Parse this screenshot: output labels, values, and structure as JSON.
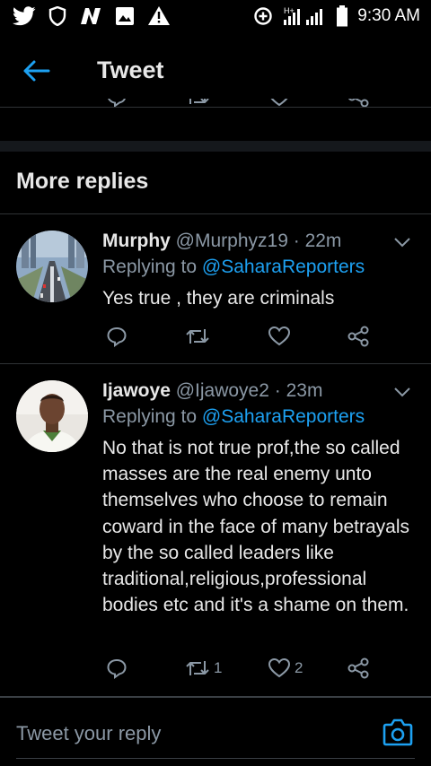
{
  "status_bar": {
    "time": "9:30 AM",
    "left_icons": [
      "twitter-icon",
      "shield-icon",
      "n-app-icon",
      "gallery-icon",
      "warning-icon"
    ],
    "right_icons": [
      "data-saver-icon",
      "signal-icon",
      "battery-icon"
    ],
    "network_type": "H+"
  },
  "header": {
    "title": "Tweet",
    "back_icon": "arrow-left-icon"
  },
  "section": {
    "title": "More replies"
  },
  "replies": [
    {
      "name": "Murphy",
      "handle": "@Murphyz19",
      "separator": "·",
      "time": "22m",
      "replying_prefix": "Replying to ",
      "replying_to": "@SaharaReporters",
      "text": "Yes true , they are criminals",
      "retweet_count": "",
      "like_count": ""
    },
    {
      "name": "Ijawoye",
      "handle": "@Ijawoye2",
      "separator": "·",
      "time": "23m",
      "replying_prefix": "Replying to ",
      "replying_to": "@SaharaReporters",
      "text": "No that is not true prof,the so called masses are the real enemy unto themselves who choose to remain coward in the face of many betrayals by the so called leaders like traditional,religious,professional bodies etc and it's a shame on them.",
      "retweet_count": "1",
      "like_count": "2"
    }
  ],
  "reply_bar": {
    "placeholder": "Tweet your reply",
    "camera_icon": "camera-icon"
  },
  "colors": {
    "accent": "#1da1f2",
    "background": "#000000",
    "muted_text": "#8b98a5",
    "divider": "#2f3336"
  }
}
